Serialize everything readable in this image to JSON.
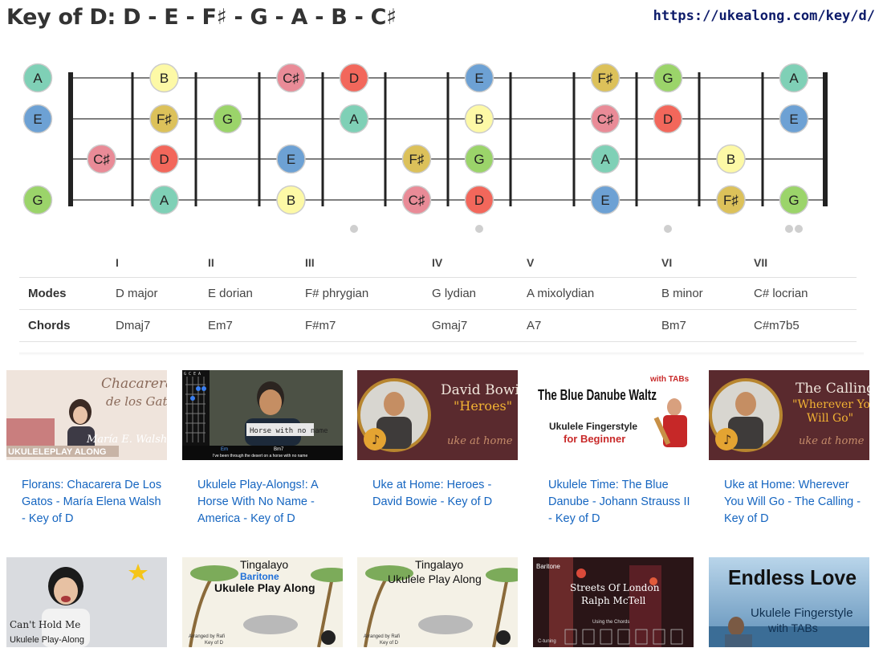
{
  "page": {
    "title": "Key of D: D - E - F♯ - G - A - B - C♯",
    "url": "https://ukealong.com/key/d/"
  },
  "fretboard": {
    "note_colors": {
      "A": "#7fd0b6",
      "B": "#fdf9a6",
      "C♯": "#e98b97",
      "D": "#f2675b",
      "E": "#6da1d4",
      "F♯": "#dcc15a",
      "G": "#9bd46a"
    },
    "strings": [
      {
        "notes": [
          [
            0,
            "A"
          ],
          [
            2,
            "B"
          ],
          [
            4,
            "C♯"
          ],
          [
            5,
            "D"
          ],
          [
            7,
            "E"
          ],
          [
            9,
            "F♯"
          ],
          [
            10,
            "G"
          ],
          [
            12,
            "A"
          ]
        ]
      },
      {
        "notes": [
          [
            0,
            "E"
          ],
          [
            2,
            "F♯"
          ],
          [
            3,
            "G"
          ],
          [
            5,
            "A"
          ],
          [
            7,
            "B"
          ],
          [
            9,
            "C♯"
          ],
          [
            10,
            "D"
          ],
          [
            12,
            "E"
          ]
        ]
      },
      {
        "notes": [
          [
            1,
            "C♯"
          ],
          [
            2,
            "D"
          ],
          [
            4,
            "E"
          ],
          [
            6,
            "F♯"
          ],
          [
            7,
            "G"
          ],
          [
            9,
            "A"
          ],
          [
            11,
            "B"
          ]
        ]
      },
      {
        "notes": [
          [
            0,
            "G"
          ],
          [
            2,
            "A"
          ],
          [
            4,
            "B"
          ],
          [
            6,
            "C♯"
          ],
          [
            7,
            "D"
          ],
          [
            9,
            "E"
          ],
          [
            11,
            "F♯"
          ],
          [
            12,
            "G"
          ]
        ]
      }
    ],
    "fret_markers": [
      5,
      7,
      10
    ],
    "double_markers": [
      12
    ]
  },
  "modes_table": {
    "degrees": [
      "I",
      "II",
      "III",
      "IV",
      "V",
      "VI",
      "VII"
    ],
    "modes_label": "Modes",
    "modes": [
      "D major",
      "E dorian",
      "F# phrygian",
      "G lydian",
      "A mixolydian",
      "B minor",
      "C# locrian"
    ],
    "chords_label": "Chords",
    "chords": [
      "Dmaj7",
      "Em7",
      "F#m7",
      "Gmaj7",
      "A7",
      "Bm7",
      "C#m7b5"
    ]
  },
  "videos": [
    {
      "title": "Florans: Chacarera De Los Gatos - María Elena Walsh - Key of D",
      "thumb": {
        "l1": "Chacarera",
        "l2": "de los Gatos",
        "l3": "María E. Walsh",
        "l4": "UKULELEPLAY ALONG"
      }
    },
    {
      "title": "Ukulele Play-Alongs!: A Horse With No Name - America - Key of D",
      "thumb": {
        "l1": "Horse with no name",
        "l2": "Em",
        "l3": "Bm7",
        "l4": "I've been through the desert on a horse with no name",
        "l5": "G C E A"
      }
    },
    {
      "title": "Uke at Home: Heroes - David Bowie - Key of D",
      "thumb": {
        "l1": "David Bowie",
        "l2": "\"Heroes\"",
        "l3": "uke at home"
      }
    },
    {
      "title": "Ukulele Time: The Blue Danube - Johann Strauss II - Key of D",
      "thumb": {
        "l1": "The Blue Danube Waltz",
        "l2": "with TABs",
        "l3": "Ukulele Fingerstyle",
        "l4": "for Beginner"
      }
    },
    {
      "title": "Uke at Home: Wherever You Will Go - The Calling - Key of D",
      "thumb": {
        "l1": "The Calling",
        "l2": "\"Wherever You",
        "l3": "Will Go\"",
        "l4": "uke at home"
      }
    }
  ],
  "videos_row2": [
    {
      "thumb": {
        "l1": "Can't Hold Me",
        "l2": "Ukulele Play-Along"
      }
    },
    {
      "thumb": {
        "l1": "Tingalayo",
        "l2": "Baritone",
        "l3": "Ukulele Play Along",
        "l4": "Arranged by Rafi",
        "l5": "Key of D"
      }
    },
    {
      "thumb": {
        "l1": "Tingalayo",
        "l2": "Ukulele Play Along",
        "l3": "Arranged by Rafi",
        "l4": "Key of D"
      }
    },
    {
      "thumb": {
        "l1": "Baritone",
        "l2": "Streets Of London",
        "l3": "Ralph McTell",
        "l4": "Using the Chords",
        "l5": "C-tuning"
      }
    },
    {
      "thumb": {
        "l1": "Endless Love",
        "l2": "Ukulele Fingerstyle",
        "l3": "with TABs"
      }
    }
  ]
}
